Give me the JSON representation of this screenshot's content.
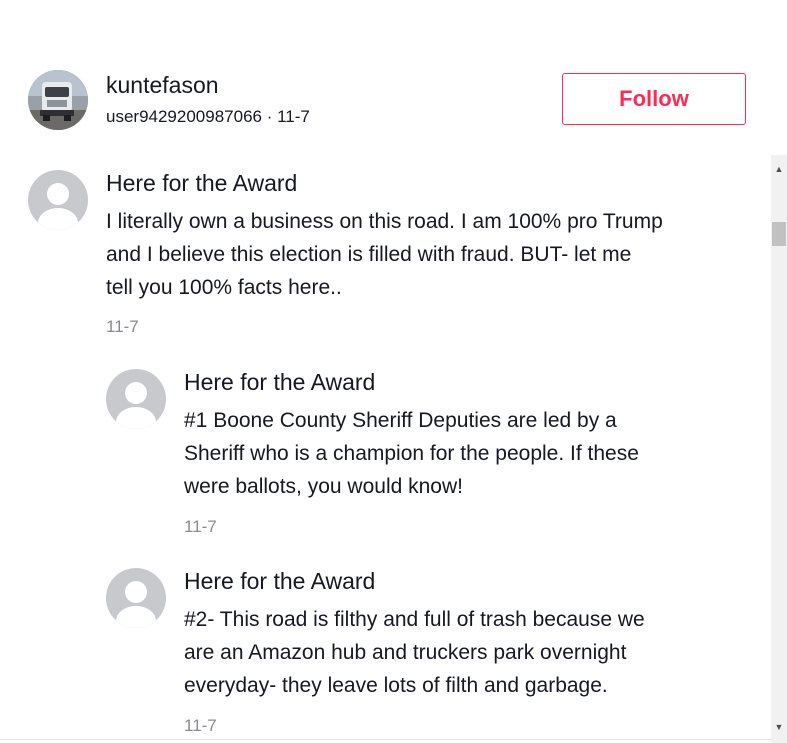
{
  "author": {
    "name": "kuntefason",
    "meta": "user9429200987066 · 11-7",
    "follow_label": "Follow"
  },
  "comments": [
    {
      "name": "Here for the Award",
      "text_lines": [
        "I literally own a business on this road. I am 100% pro Trump",
        "and I believe this election is filled with fraud. BUT- let me",
        "tell you 100% facts here.."
      ],
      "date": "11-7"
    },
    {
      "name": "Here for the Award",
      "text_lines": [
        "#1 Boone County Sheriff Deputies are led by a",
        "Sheriff who is a champion for the people. If these",
        "were ballots, you would know!"
      ],
      "date": "11-7"
    },
    {
      "name": "Here for the Award",
      "text_lines": [
        "#2- This road is filthy and full of trash because we",
        "are an Amazon hub and truckers park overnight",
        "everyday- they leave lots of filth and garbage."
      ],
      "date": "11-7"
    }
  ],
  "icons": {
    "scroll_up": "scroll-up-arrow",
    "scroll_down": "scroll-down-arrow",
    "default_avatar": "default-avatar-icon",
    "author_avatar": "truck-photo-avatar"
  },
  "colors": {
    "accent": "#fe2c55",
    "text": "#161823",
    "muted": "#8a8b91",
    "avatar_placeholder": "#c7c9cd"
  }
}
